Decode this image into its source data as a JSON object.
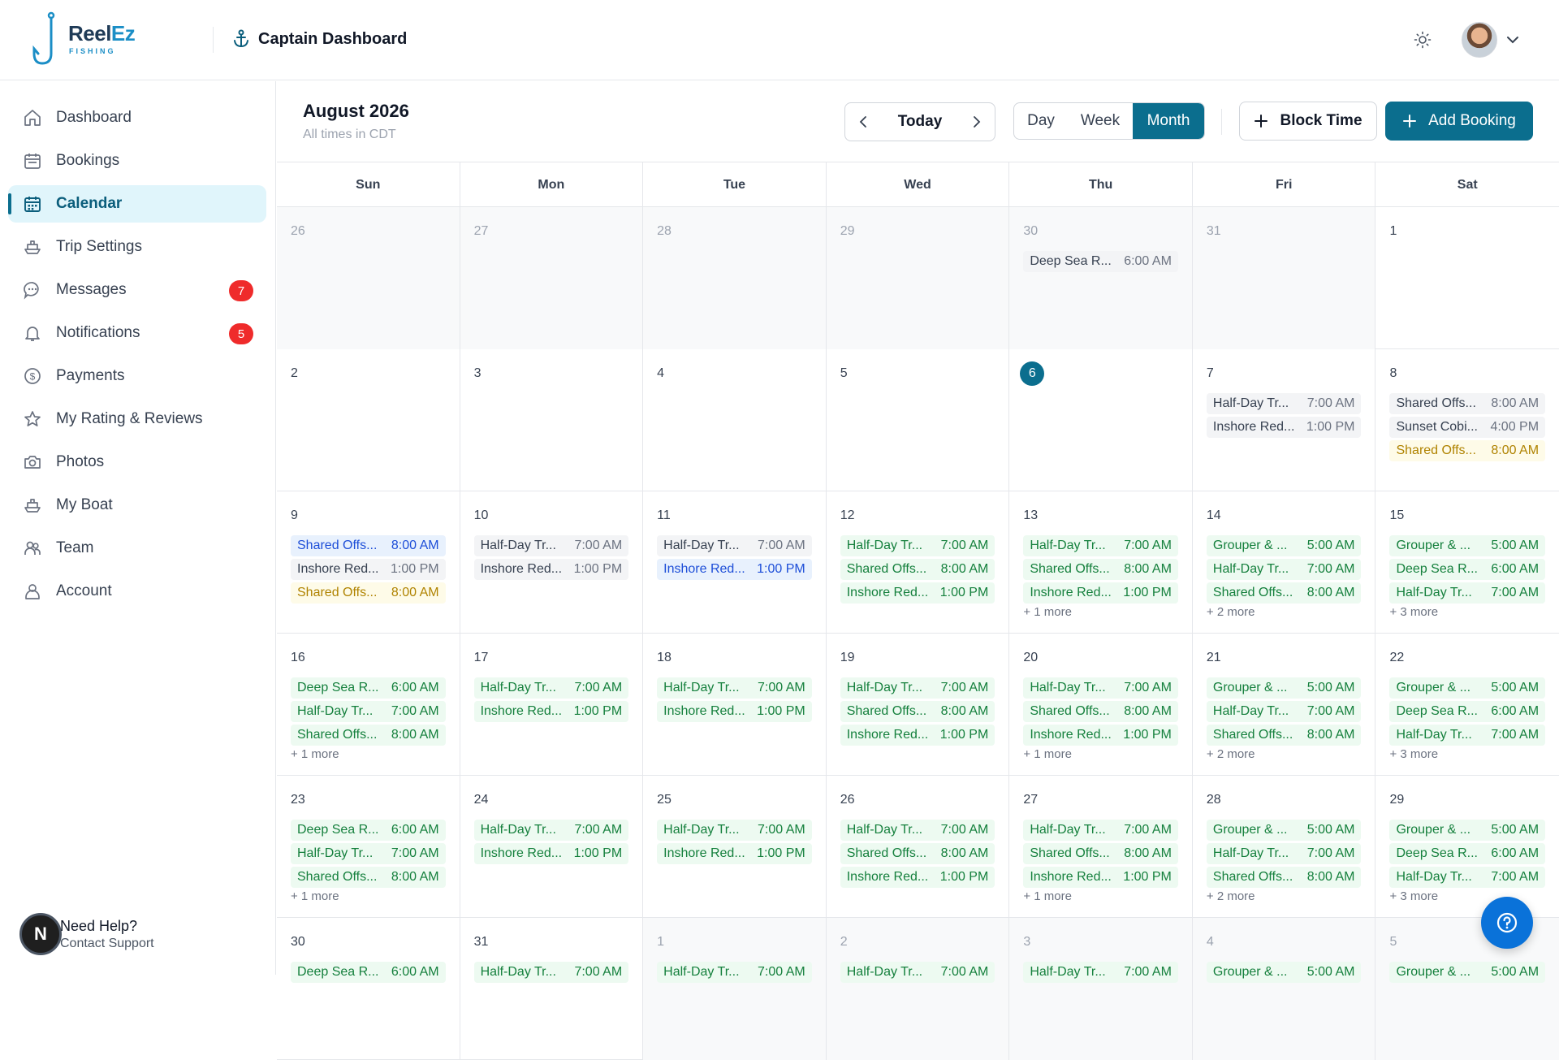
{
  "header": {
    "logo_reel": "Reel",
    "logo_ez": "Ez",
    "logo_sub": "FISHING",
    "title": "Captain Dashboard"
  },
  "sidebar": {
    "items": [
      {
        "label": "Dashboard",
        "icon": "home-icon"
      },
      {
        "label": "Bookings",
        "icon": "calendar-list-icon"
      },
      {
        "label": "Calendar",
        "icon": "calendar-icon",
        "active": true
      },
      {
        "label": "Trip Settings",
        "icon": "boat-icon"
      },
      {
        "label": "Messages",
        "icon": "chat-icon",
        "badge": "7"
      },
      {
        "label": "Notifications",
        "icon": "bell-icon",
        "badge": "5"
      },
      {
        "label": "Payments",
        "icon": "dollar-icon"
      },
      {
        "label": "My Rating & Reviews",
        "icon": "star-icon"
      },
      {
        "label": "Photos",
        "icon": "camera-icon"
      },
      {
        "label": "My Boat",
        "icon": "boat-icon"
      },
      {
        "label": "Team",
        "icon": "team-icon"
      },
      {
        "label": "Account",
        "icon": "user-icon"
      }
    ],
    "help_title": "Need Help?",
    "help_link": "Contact Support",
    "help_avatar": "N"
  },
  "calendar": {
    "title": "August 2026",
    "subtitle": "All times in CDT",
    "today_label": "Today",
    "views": {
      "day": "Day",
      "week": "Week",
      "month": "Month"
    },
    "block_time": "Block Time",
    "add_booking": "Add Booking",
    "days_of_week": [
      "Sun",
      "Mon",
      "Tue",
      "Wed",
      "Thu",
      "Fri",
      "Sat"
    ],
    "weeks": [
      [
        {
          "d": "26",
          "other": true,
          "events": []
        },
        {
          "d": "27",
          "other": true,
          "events": []
        },
        {
          "d": "28",
          "other": true,
          "events": []
        },
        {
          "d": "29",
          "other": true,
          "events": []
        },
        {
          "d": "30",
          "other": true,
          "events": [
            {
              "n": "Deep Sea R...",
              "t": "6:00 AM",
              "c": "gray"
            }
          ]
        },
        {
          "d": "31",
          "other": true,
          "events": []
        },
        {
          "d": "1",
          "events": []
        }
      ],
      [
        {
          "d": "2",
          "events": []
        },
        {
          "d": "3",
          "events": []
        },
        {
          "d": "4",
          "events": []
        },
        {
          "d": "5",
          "events": []
        },
        {
          "d": "6",
          "today": true,
          "events": []
        },
        {
          "d": "7",
          "events": [
            {
              "n": "Half-Day Tr...",
              "t": "7:00 AM",
              "c": "gray"
            },
            {
              "n": "Inshore Red...",
              "t": "1:00 PM",
              "c": "gray"
            }
          ]
        },
        {
          "d": "8",
          "events": [
            {
              "n": "Shared Offs...",
              "t": "8:00 AM",
              "c": "gray"
            },
            {
              "n": "Sunset Cobi...",
              "t": "4:00 PM",
              "c": "gray"
            },
            {
              "n": "Shared Offs...",
              "t": "8:00 AM",
              "c": "yellow"
            }
          ]
        }
      ],
      [
        {
          "d": "9",
          "events": [
            {
              "n": "Shared Offs...",
              "t": "8:00 AM",
              "c": "blue"
            },
            {
              "n": "Inshore Red...",
              "t": "1:00 PM",
              "c": "gray"
            },
            {
              "n": "Shared Offs...",
              "t": "8:00 AM",
              "c": "yellow"
            }
          ]
        },
        {
          "d": "10",
          "events": [
            {
              "n": "Half-Day Tr...",
              "t": "7:00 AM",
              "c": "gray"
            },
            {
              "n": "Inshore Red...",
              "t": "1:00 PM",
              "c": "gray"
            }
          ]
        },
        {
          "d": "11",
          "events": [
            {
              "n": "Half-Day Tr...",
              "t": "7:00 AM",
              "c": "gray"
            },
            {
              "n": "Inshore Red...",
              "t": "1:00 PM",
              "c": "blue"
            }
          ]
        },
        {
          "d": "12",
          "events": [
            {
              "n": "Half-Day Tr...",
              "t": "7:00 AM",
              "c": "green"
            },
            {
              "n": "Shared Offs...",
              "t": "8:00 AM",
              "c": "green"
            },
            {
              "n": "Inshore Red...",
              "t": "1:00 PM",
              "c": "green"
            }
          ]
        },
        {
          "d": "13",
          "events": [
            {
              "n": "Half-Day Tr...",
              "t": "7:00 AM",
              "c": "green"
            },
            {
              "n": "Shared Offs...",
              "t": "8:00 AM",
              "c": "green"
            },
            {
              "n": "Inshore Red...",
              "t": "1:00 PM",
              "c": "green"
            }
          ],
          "more": "+ 1 more"
        },
        {
          "d": "14",
          "events": [
            {
              "n": "Grouper & ...",
              "t": "5:00 AM",
              "c": "green"
            },
            {
              "n": "Half-Day Tr...",
              "t": "7:00 AM",
              "c": "green"
            },
            {
              "n": "Shared Offs...",
              "t": "8:00 AM",
              "c": "green"
            }
          ],
          "more": "+ 2 more"
        },
        {
          "d": "15",
          "events": [
            {
              "n": "Grouper & ...",
              "t": "5:00 AM",
              "c": "green"
            },
            {
              "n": "Deep Sea R...",
              "t": "6:00 AM",
              "c": "green"
            },
            {
              "n": "Half-Day Tr...",
              "t": "7:00 AM",
              "c": "green"
            }
          ],
          "more": "+ 3 more"
        }
      ],
      [
        {
          "d": "16",
          "events": [
            {
              "n": "Deep Sea R...",
              "t": "6:00 AM",
              "c": "green"
            },
            {
              "n": "Half-Day Tr...",
              "t": "7:00 AM",
              "c": "green"
            },
            {
              "n": "Shared Offs...",
              "t": "8:00 AM",
              "c": "green"
            }
          ],
          "more": "+ 1 more"
        },
        {
          "d": "17",
          "events": [
            {
              "n": "Half-Day Tr...",
              "t": "7:00 AM",
              "c": "green"
            },
            {
              "n": "Inshore Red...",
              "t": "1:00 PM",
              "c": "green"
            }
          ]
        },
        {
          "d": "18",
          "events": [
            {
              "n": "Half-Day Tr...",
              "t": "7:00 AM",
              "c": "green"
            },
            {
              "n": "Inshore Red...",
              "t": "1:00 PM",
              "c": "green"
            }
          ]
        },
        {
          "d": "19",
          "events": [
            {
              "n": "Half-Day Tr...",
              "t": "7:00 AM",
              "c": "green"
            },
            {
              "n": "Shared Offs...",
              "t": "8:00 AM",
              "c": "green"
            },
            {
              "n": "Inshore Red...",
              "t": "1:00 PM",
              "c": "green"
            }
          ]
        },
        {
          "d": "20",
          "events": [
            {
              "n": "Half-Day Tr...",
              "t": "7:00 AM",
              "c": "green"
            },
            {
              "n": "Shared Offs...",
              "t": "8:00 AM",
              "c": "green"
            },
            {
              "n": "Inshore Red...",
              "t": "1:00 PM",
              "c": "green"
            }
          ],
          "more": "+ 1 more"
        },
        {
          "d": "21",
          "events": [
            {
              "n": "Grouper & ...",
              "t": "5:00 AM",
              "c": "green"
            },
            {
              "n": "Half-Day Tr...",
              "t": "7:00 AM",
              "c": "green"
            },
            {
              "n": "Shared Offs...",
              "t": "8:00 AM",
              "c": "green"
            }
          ],
          "more": "+ 2 more"
        },
        {
          "d": "22",
          "events": [
            {
              "n": "Grouper & ...",
              "t": "5:00 AM",
              "c": "green"
            },
            {
              "n": "Deep Sea R...",
              "t": "6:00 AM",
              "c": "green"
            },
            {
              "n": "Half-Day Tr...",
              "t": "7:00 AM",
              "c": "green"
            }
          ],
          "more": "+ 3 more"
        }
      ],
      [
        {
          "d": "23",
          "events": [
            {
              "n": "Deep Sea R...",
              "t": "6:00 AM",
              "c": "green"
            },
            {
              "n": "Half-Day Tr...",
              "t": "7:00 AM",
              "c": "green"
            },
            {
              "n": "Shared Offs...",
              "t": "8:00 AM",
              "c": "green"
            }
          ],
          "more": "+ 1 more"
        },
        {
          "d": "24",
          "events": [
            {
              "n": "Half-Day Tr...",
              "t": "7:00 AM",
              "c": "green"
            },
            {
              "n": "Inshore Red...",
              "t": "1:00 PM",
              "c": "green"
            }
          ]
        },
        {
          "d": "25",
          "events": [
            {
              "n": "Half-Day Tr...",
              "t": "7:00 AM",
              "c": "green"
            },
            {
              "n": "Inshore Red...",
              "t": "1:00 PM",
              "c": "green"
            }
          ]
        },
        {
          "d": "26",
          "events": [
            {
              "n": "Half-Day Tr...",
              "t": "7:00 AM",
              "c": "green"
            },
            {
              "n": "Shared Offs...",
              "t": "8:00 AM",
              "c": "green"
            },
            {
              "n": "Inshore Red...",
              "t": "1:00 PM",
              "c": "green"
            }
          ]
        },
        {
          "d": "27",
          "events": [
            {
              "n": "Half-Day Tr...",
              "t": "7:00 AM",
              "c": "green"
            },
            {
              "n": "Shared Offs...",
              "t": "8:00 AM",
              "c": "green"
            },
            {
              "n": "Inshore Red...",
              "t": "1:00 PM",
              "c": "green"
            }
          ],
          "more": "+ 1 more"
        },
        {
          "d": "28",
          "events": [
            {
              "n": "Grouper & ...",
              "t": "5:00 AM",
              "c": "green"
            },
            {
              "n": "Half-Day Tr...",
              "t": "7:00 AM",
              "c": "green"
            },
            {
              "n": "Shared Offs...",
              "t": "8:00 AM",
              "c": "green"
            }
          ],
          "more": "+ 2 more"
        },
        {
          "d": "29",
          "events": [
            {
              "n": "Grouper & ...",
              "t": "5:00 AM",
              "c": "green"
            },
            {
              "n": "Deep Sea R...",
              "t": "6:00 AM",
              "c": "green"
            },
            {
              "n": "Half-Day Tr...",
              "t": "7:00 AM",
              "c": "green"
            }
          ],
          "more": "+ 3 more"
        }
      ],
      [
        {
          "d": "30",
          "events": [
            {
              "n": "Deep Sea R...",
              "t": "6:00 AM",
              "c": "green"
            }
          ]
        },
        {
          "d": "31",
          "events": [
            {
              "n": "Half-Day Tr...",
              "t": "7:00 AM",
              "c": "green"
            }
          ]
        },
        {
          "d": "1",
          "other": true,
          "events": [
            {
              "n": "Half-Day Tr...",
              "t": "7:00 AM",
              "c": "green"
            }
          ]
        },
        {
          "d": "2",
          "other": true,
          "events": [
            {
              "n": "Half-Day Tr...",
              "t": "7:00 AM",
              "c": "green"
            }
          ]
        },
        {
          "d": "3",
          "other": true,
          "events": [
            {
              "n": "Half-Day Tr...",
              "t": "7:00 AM",
              "c": "green"
            }
          ]
        },
        {
          "d": "4",
          "other": true,
          "events": [
            {
              "n": "Grouper & ...",
              "t": "5:00 AM",
              "c": "green"
            }
          ]
        },
        {
          "d": "5",
          "other": true,
          "events": [
            {
              "n": "Grouper & ...",
              "t": "5:00 AM",
              "c": "green"
            }
          ]
        }
      ]
    ]
  },
  "colors": {
    "primary": "#0b6e8e",
    "active_bg": "#e0f5fb",
    "badge": "#ef2b2b",
    "fab": "#0a72d9",
    "event_green": "#15803d",
    "event_blue": "#1d4ed8",
    "event_yellow": "#b08300"
  }
}
